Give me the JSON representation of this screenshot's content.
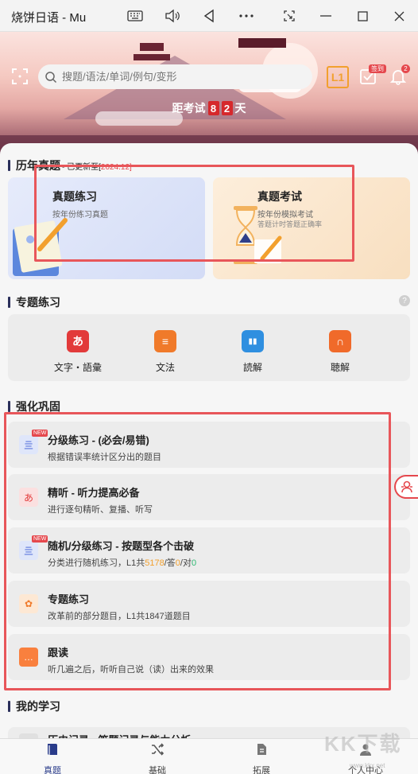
{
  "window": {
    "title": "烧饼日语 - Mu",
    "controls": [
      "keyboard-icon",
      "volume-icon",
      "back-icon",
      "more-icon",
      "screenshot-icon",
      "minimize-icon",
      "maximize-icon",
      "close-icon"
    ]
  },
  "header": {
    "search_placeholder": "搜题/语法/单词/例句/变形",
    "level": "L1",
    "checkin_tag": "签到",
    "notification_count": "2",
    "countdown_prefix": "距考试",
    "countdown_digits": [
      "8",
      "2"
    ],
    "countdown_suffix": "天"
  },
  "past_exams": {
    "title": "历年真题",
    "update_prefix": "- 已更新至[",
    "update_value": "2024.12",
    "update_suffix": "]",
    "cards": [
      {
        "title": "真题练习",
        "subtitle": "按年份练习真题",
        "extra": ""
      },
      {
        "title": "真题考试",
        "subtitle": "按年份模拟考试",
        "extra": "答题计时答题正确率"
      }
    ]
  },
  "topics": {
    "title": "专题练习",
    "items": [
      {
        "label": "文字・語彙",
        "icon": "vocabulary-icon",
        "glyph": "あ",
        "color": "#e23a3a"
      },
      {
        "label": "文法",
        "icon": "grammar-icon",
        "glyph": "≡",
        "color": "#f07a2a"
      },
      {
        "label": "読解",
        "icon": "reading-icon",
        "glyph": "▮▮",
        "color": "#2f8fe0"
      },
      {
        "label": "聴解",
        "icon": "listening-icon",
        "glyph": "∩",
        "color": "#f06a2a"
      }
    ]
  },
  "reinforce": {
    "title": "强化巩固",
    "new_tag": "NEW",
    "items": [
      {
        "title": "分级练习 - (必会/易错)",
        "desc": "根据错误率统计区分出的题目",
        "new": true,
        "icon": "level-practice-icon",
        "glyph": "亖",
        "bg": "#dfe6fa",
        "fg": "#3b5bd6"
      },
      {
        "title": "精听 - 听力提高必备",
        "desc": "进行逐句精听、复播、听写",
        "new": false,
        "icon": "intensive-listening-icon",
        "glyph": "あ",
        "bg": "#fbe0e0",
        "fg": "#e23a3a"
      },
      {
        "title": "随机/分级练习 - 按题型各个击破",
        "desc_prefix": "分类进行随机练习，L1共",
        "desc_total": "5178",
        "desc_mid": "/答",
        "desc_answered": "0",
        "desc_mid2": "/对",
        "desc_correct": "0",
        "new": true,
        "icon": "random-practice-icon",
        "glyph": "亖",
        "bg": "#dfe6fa",
        "fg": "#3b5bd6"
      },
      {
        "title": "专题练习",
        "desc": "改革前的部分题目，L1共1847道题目",
        "new": false,
        "icon": "topic-practice-icon",
        "glyph": "✿",
        "bg": "#fde8d4",
        "fg": "#f07a2a"
      },
      {
        "title": "跟读",
        "desc": "听几遍之后，听听自己说（读）出来的效果",
        "new": false,
        "icon": "shadowing-icon",
        "glyph": "…",
        "bg": "#fde0d0",
        "fg": "#f06a2a"
      }
    ]
  },
  "my_study": {
    "title": "我的学习",
    "first_item": "历史记录 - 答题记录与能力分析"
  },
  "bottom_nav": [
    {
      "label": "真题",
      "icon": "book-icon",
      "active": true
    },
    {
      "label": "基础",
      "icon": "shuffle-icon",
      "active": false
    },
    {
      "label": "拓展",
      "icon": "document-icon",
      "active": false
    },
    {
      "label": "个人中心",
      "icon": "user-icon",
      "active": false
    }
  ],
  "watermark": {
    "text": "KK下载",
    "url": "www.kkx.net"
  }
}
